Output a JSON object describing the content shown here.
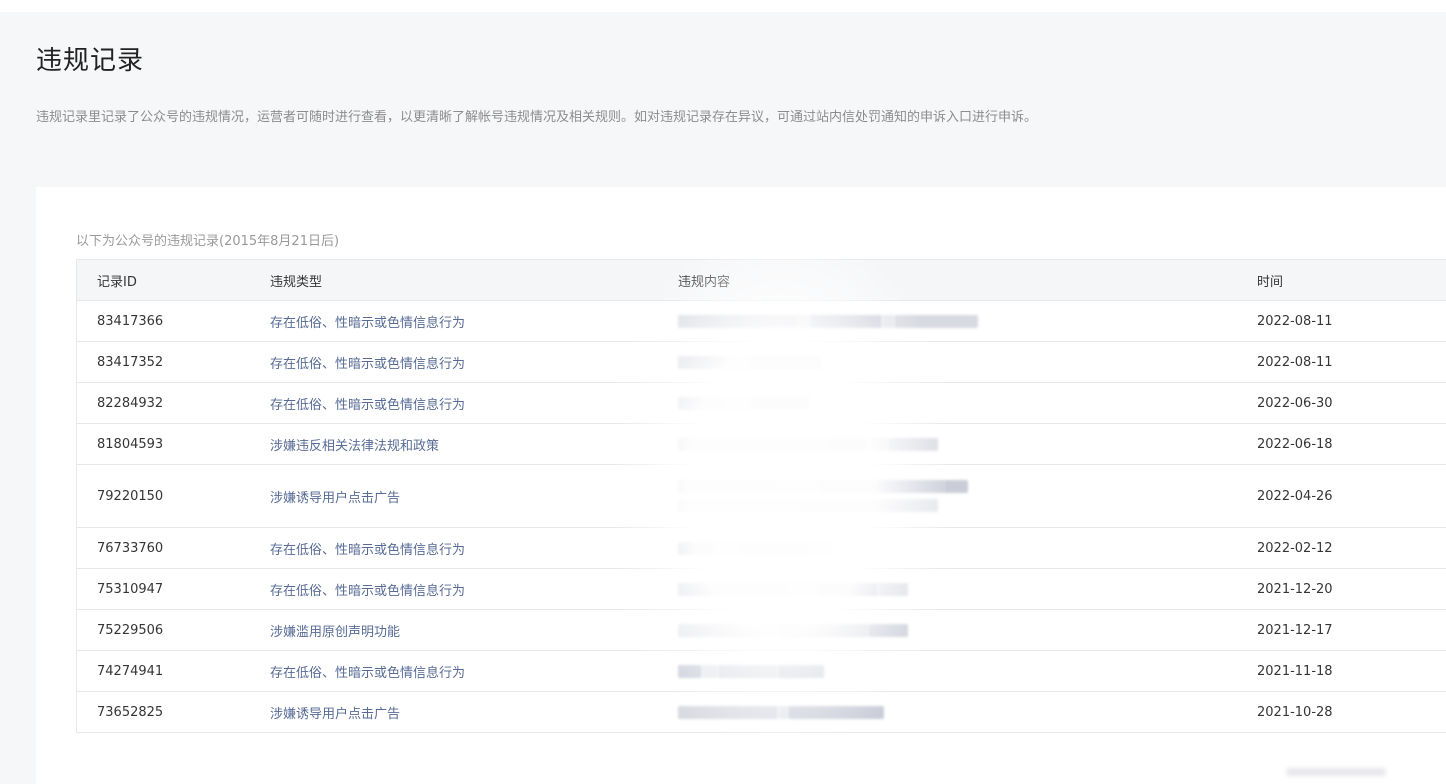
{
  "page": {
    "title": "违规记录",
    "description": "违规记录里记录了公众号的违规情况，运营者可随时进行查看，以更清晰了解帐号违规情况及相关规则。如对违规记录存在异议，可通过站内信处罚通知的申诉入口进行申诉。"
  },
  "table": {
    "caption": "以下为公众号的违规记录(2015年8月21日后)",
    "columns": {
      "id": "记录ID",
      "type": "违规类型",
      "content": "违规内容",
      "time": "时间"
    },
    "rows": [
      {
        "id": "83417366",
        "type": "存在低俗、性暗示或色情信息行为",
        "time": "2022-08-11"
      },
      {
        "id": "83417352",
        "type": "存在低俗、性暗示或色情信息行为",
        "time": "2022-08-11"
      },
      {
        "id": "82284932",
        "type": "存在低俗、性暗示或色情信息行为",
        "time": "2022-06-30"
      },
      {
        "id": "81804593",
        "type": "涉嫌违反相关法律法规和政策",
        "time": "2022-06-18"
      },
      {
        "id": "79220150",
        "type": "涉嫌诱导用户点击广告",
        "time": "2022-04-26"
      },
      {
        "id": "76733760",
        "type": "存在低俗、性暗示或色情信息行为",
        "time": "2022-02-12"
      },
      {
        "id": "75310947",
        "type": "存在低俗、性暗示或色情信息行为",
        "time": "2021-12-20"
      },
      {
        "id": "75229506",
        "type": "涉嫌滥用原创声明功能",
        "time": "2021-12-17"
      },
      {
        "id": "74274941",
        "type": "存在低俗、性暗示或色情信息行为",
        "time": "2021-11-18"
      },
      {
        "id": "73652825",
        "type": "涉嫌诱导用户点击广告",
        "time": "2021-10-28"
      }
    ]
  }
}
